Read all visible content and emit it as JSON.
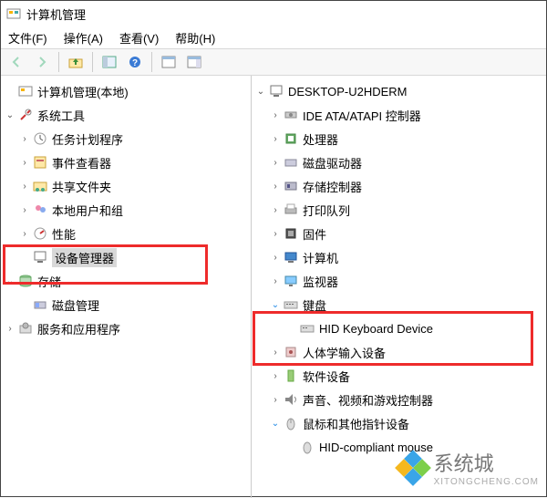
{
  "window": {
    "title": "计算机管理"
  },
  "menu": {
    "file": "文件(F)",
    "action": "操作(A)",
    "view": "查看(V)",
    "help": "帮助(H)"
  },
  "toolbar_icons": [
    "back",
    "forward",
    "up",
    "properties",
    "refresh",
    "help",
    "panel1",
    "panel2"
  ],
  "left_tree": {
    "root": "计算机管理(本地)",
    "system_tools": "系统工具",
    "task_scheduler": "任务计划程序",
    "event_viewer": "事件查看器",
    "shared_folders": "共享文件夹",
    "local_users": "本地用户和组",
    "performance": "性能",
    "device_manager": "设备管理器",
    "storage": "存储",
    "disk_mgmt": "磁盘管理",
    "services_apps": "服务和应用程序"
  },
  "right_tree": {
    "root": "DESKTOP-U2HDERM",
    "ide": "IDE ATA/ATAPI 控制器",
    "cpu": "处理器",
    "disk_drives": "磁盘驱动器",
    "storage_ctrl": "存储控制器",
    "print_queue": "打印队列",
    "firmware": "固件",
    "computer": "计算机",
    "monitor": "监视器",
    "keyboard": "键盘",
    "hid_kb": "HID Keyboard Device",
    "hid_input": "人体学输入设备",
    "software_dev": "软件设备",
    "sound": "声音、视频和游戏控制器",
    "mouse": "鼠标和其他指针设备",
    "hid_mouse": "HID-compliant mouse"
  },
  "watermark": {
    "brand": "系统城",
    "sub": "XITONGCHENG.COM"
  }
}
